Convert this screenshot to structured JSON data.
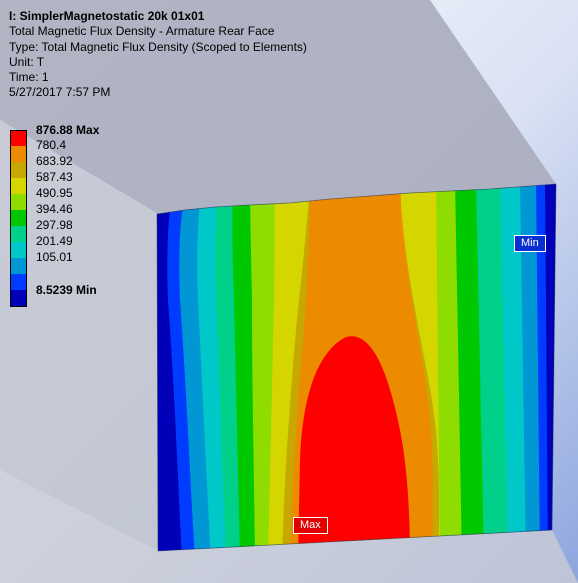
{
  "info": {
    "title": "I: SimplerMagnetostatic 20k 01x01",
    "line1": "Total Magnetic Flux Density - Armature Rear Face",
    "line2": "Type: Total Magnetic Flux Density (Scoped to Elements)",
    "line3": "Unit: T",
    "line4": "Time: 1",
    "line5": "5/27/2017 7:57 PM"
  },
  "legend": {
    "max_label": "876.88 Max",
    "min_label": "8.5239 Min",
    "levels": [
      "780.4",
      "683.92",
      "587.43",
      "490.95",
      "394.46",
      "297.98",
      "201.49",
      "105.01"
    ],
    "colors": [
      "#ff0000",
      "#ec8a00",
      "#c7a800",
      "#d5d500",
      "#8fdc00",
      "#00c800",
      "#00d08a",
      "#00c8c8",
      "#0097d4",
      "#003cff",
      "#0000b8"
    ]
  },
  "probes": {
    "max_tag": "Max",
    "min_tag": "Min"
  }
}
